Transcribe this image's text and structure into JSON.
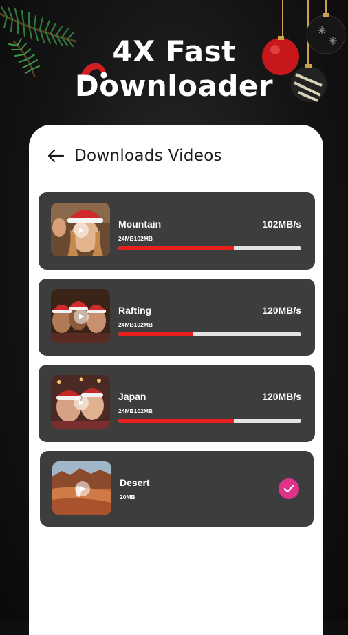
{
  "headline": {
    "line1": "4X Fast",
    "line2": "Downloader"
  },
  "header": {
    "title": "Downloads Videos"
  },
  "downloads": [
    {
      "name": "Mountain",
      "size": "24MB102MB",
      "speed": "102MB/s",
      "progress": 0.63,
      "completed": false
    },
    {
      "name": "Rafting",
      "size": "24MB102MB",
      "speed": "120MB/s",
      "progress": 0.41,
      "completed": false
    },
    {
      "name": "Japan",
      "size": "24MB102MB",
      "speed": "120MB/s",
      "progress": 0.63,
      "completed": false
    },
    {
      "name": "Desert",
      "size": "20MB",
      "completed": true
    }
  ],
  "colors": {
    "progress": "#e8201e",
    "check": "#e2318a",
    "card": "#3d3d3d"
  }
}
